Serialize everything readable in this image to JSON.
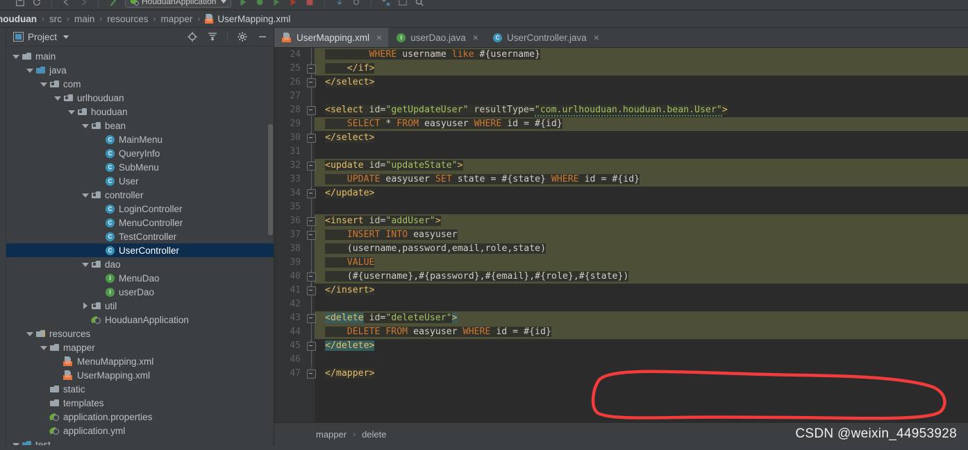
{
  "window": {
    "run_configuration": "HouduanApplication"
  },
  "breadcrumb": {
    "items": [
      "houduan",
      "src",
      "main",
      "resources",
      "mapper",
      "UserMapping.xml"
    ],
    "separator": "›"
  },
  "project_panel": {
    "title": "Project",
    "actions": [
      "locate-icon",
      "collapse-all-icon",
      "settings-gear-icon",
      "minimize-icon"
    ],
    "tree": [
      {
        "label": "main",
        "depth": 1,
        "arrow": "down",
        "icon": "folder"
      },
      {
        "label": "java",
        "depth": 2,
        "arrow": "down",
        "icon": "folder-source"
      },
      {
        "label": "com",
        "depth": 3,
        "arrow": "down",
        "icon": "package"
      },
      {
        "label": "urlhouduan",
        "depth": 4,
        "arrow": "down",
        "icon": "package"
      },
      {
        "label": "houduan",
        "depth": 5,
        "arrow": "down",
        "icon": "package"
      },
      {
        "label": "bean",
        "depth": 6,
        "arrow": "down",
        "icon": "package"
      },
      {
        "label": "MainMenu",
        "depth": 7,
        "arrow": "none",
        "icon": "class"
      },
      {
        "label": "QueryInfo",
        "depth": 7,
        "arrow": "none",
        "icon": "class"
      },
      {
        "label": "SubMenu",
        "depth": 7,
        "arrow": "none",
        "icon": "class"
      },
      {
        "label": "User",
        "depth": 7,
        "arrow": "none",
        "icon": "class"
      },
      {
        "label": "controller",
        "depth": 6,
        "arrow": "down",
        "icon": "package"
      },
      {
        "label": "LoginController",
        "depth": 7,
        "arrow": "none",
        "icon": "class"
      },
      {
        "label": "MenuController",
        "depth": 7,
        "arrow": "none",
        "icon": "class"
      },
      {
        "label": "TestController",
        "depth": 7,
        "arrow": "none",
        "icon": "class"
      },
      {
        "label": "UserController",
        "depth": 7,
        "arrow": "none",
        "icon": "class",
        "selected": true
      },
      {
        "label": "dao",
        "depth": 6,
        "arrow": "down",
        "icon": "package"
      },
      {
        "label": "MenuDao",
        "depth": 7,
        "arrow": "none",
        "icon": "interface"
      },
      {
        "label": "userDao",
        "depth": 7,
        "arrow": "none",
        "icon": "interface"
      },
      {
        "label": "util",
        "depth": 6,
        "arrow": "right",
        "icon": "package"
      },
      {
        "label": "HouduanApplication",
        "depth": 6,
        "arrow": "none",
        "icon": "spring"
      },
      {
        "label": "resources",
        "depth": 2,
        "arrow": "down",
        "icon": "folder-resources"
      },
      {
        "label": "mapper",
        "depth": 3,
        "arrow": "down",
        "icon": "folder"
      },
      {
        "label": "MenuMapping.xml",
        "depth": 4,
        "arrow": "none",
        "icon": "xml"
      },
      {
        "label": "UserMapping.xml",
        "depth": 4,
        "arrow": "none",
        "icon": "xml"
      },
      {
        "label": "static",
        "depth": 3,
        "arrow": "none",
        "icon": "folder"
      },
      {
        "label": "templates",
        "depth": 3,
        "arrow": "none",
        "icon": "folder"
      },
      {
        "label": "application.properties",
        "depth": 3,
        "arrow": "none",
        "icon": "spring"
      },
      {
        "label": "application.yml",
        "depth": 3,
        "arrow": "none",
        "icon": "spring"
      },
      {
        "label": "test",
        "depth": 1,
        "arrow": "down",
        "icon": "folder-test"
      }
    ]
  },
  "editor": {
    "tabs": [
      {
        "label": "UserMapping.xml",
        "icon": "xml",
        "active": true,
        "close": "×"
      },
      {
        "label": "userDao.java",
        "icon": "interface",
        "active": false,
        "close": "×"
      },
      {
        "label": "UserController.java",
        "icon": "class",
        "active": false,
        "close": "×"
      }
    ],
    "first_line_number": 24,
    "lines": [
      {
        "n": 24,
        "highlight": true,
        "fold": "none",
        "text": "        WHERE username like #{username}"
      },
      {
        "n": 25,
        "highlight": true,
        "fold": "end",
        "text": "    </if>"
      },
      {
        "n": 26,
        "highlight": false,
        "fold": "end",
        "text": "</select>"
      },
      {
        "n": 27,
        "highlight": false,
        "fold": "none",
        "text": ""
      },
      {
        "n": 28,
        "highlight": false,
        "fold": "start",
        "text": "<select id=\"getUpdateUser\" resultType=\"com.urlhouduan.houduan.bean.User\">"
      },
      {
        "n": 29,
        "highlight": true,
        "fold": "none",
        "text": "    SELECT * FROM easyuser WHERE id = #{id}"
      },
      {
        "n": 30,
        "highlight": false,
        "fold": "end",
        "text": "</select>"
      },
      {
        "n": 31,
        "highlight": false,
        "fold": "none",
        "text": ""
      },
      {
        "n": 32,
        "highlight": true,
        "fold": "start",
        "text": "<update id=\"updateState\">"
      },
      {
        "n": 33,
        "highlight": true,
        "fold": "none",
        "text": "    UPDATE easyuser SET state = #{state} WHERE id = #{id}"
      },
      {
        "n": 34,
        "highlight": false,
        "fold": "end",
        "text": "</update>"
      },
      {
        "n": 35,
        "highlight": false,
        "fold": "none",
        "text": ""
      },
      {
        "n": 36,
        "highlight": true,
        "fold": "start",
        "text": "<insert id=\"addUser\">"
      },
      {
        "n": 37,
        "highlight": true,
        "fold": "start",
        "text": "    INSERT INTO easyuser"
      },
      {
        "n": 38,
        "highlight": true,
        "fold": "none",
        "text": "    (username,password,email,role,state)"
      },
      {
        "n": 39,
        "highlight": true,
        "fold": "none",
        "text": "    VALUE"
      },
      {
        "n": 40,
        "highlight": true,
        "fold": "end",
        "text": "    (#{username},#{password},#{email},#{role},#{state})"
      },
      {
        "n": 41,
        "highlight": false,
        "fold": "end",
        "text": "</insert>"
      },
      {
        "n": 42,
        "highlight": false,
        "fold": "none",
        "text": ""
      },
      {
        "n": 43,
        "highlight": true,
        "fold": "start",
        "text": "<delete id=\"deleteUser\">"
      },
      {
        "n": 44,
        "highlight": true,
        "fold": "none",
        "text": "    DELETE FROM easyuser WHERE id = #{id}"
      },
      {
        "n": 45,
        "highlight": false,
        "fold": "end",
        "text": "</delete>"
      },
      {
        "n": 46,
        "highlight": false,
        "fold": "none",
        "text": ""
      },
      {
        "n": 47,
        "highlight": false,
        "fold": "end",
        "text": "</mapper>"
      }
    ],
    "annotation": {
      "shape": "red-ellipse-highlight",
      "color": "#f23b3b",
      "covers_lines": [
        42,
        43,
        44,
        45,
        46
      ]
    }
  },
  "status_bar": {
    "breadcrumb": [
      "mapper",
      "delete"
    ],
    "separator": "›"
  },
  "watermark": "CSDN @weixin_44953928",
  "colors": {
    "panel_bg": "#3c3f41",
    "editor_bg": "#2b2b2b",
    "gutter_bg": "#313335",
    "selection_bg": "#0d2d4e",
    "highlight_block": "#4e4f37",
    "tag": "#e8bf6a",
    "attr_value": "#a5c261",
    "sql_keyword": "#cc7832",
    "annotation_red": "#f23b3b",
    "brace_match": "#365d5b"
  }
}
